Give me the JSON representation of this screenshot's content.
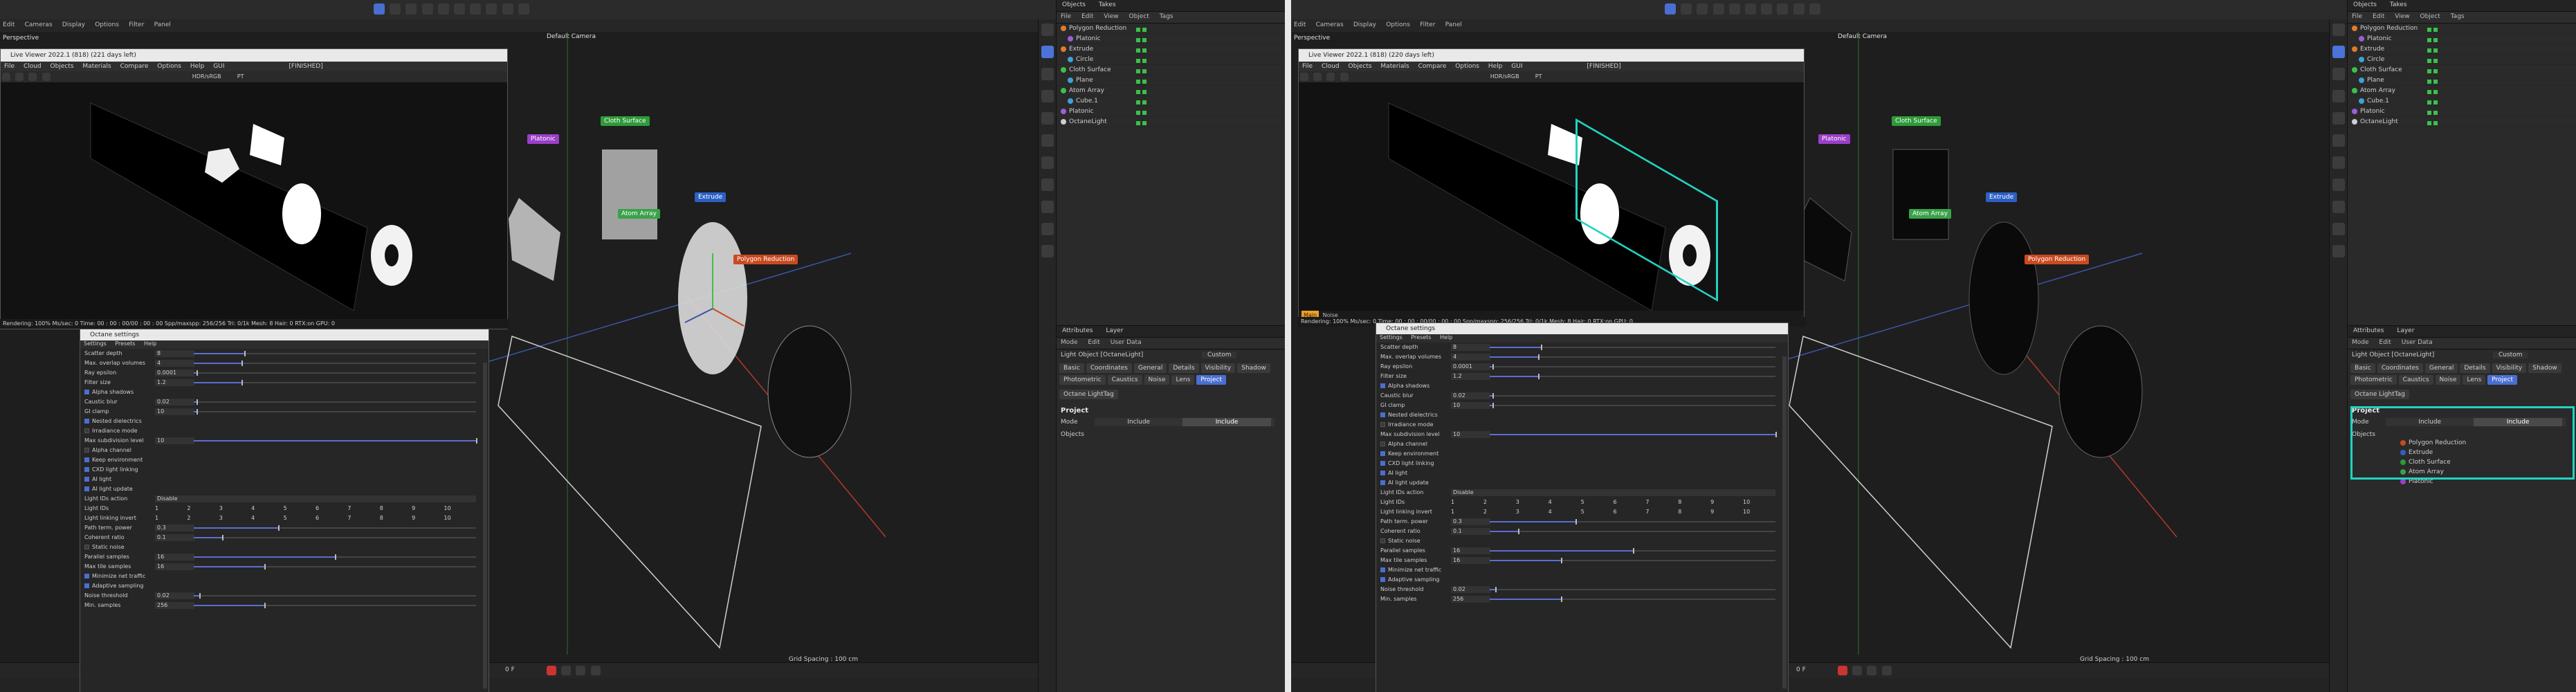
{
  "app": {
    "viewport_mode_left": "Perspective",
    "viewport_mode_right": "Perspective",
    "camera_label": "Default Camera",
    "grid_spacing": "Grid Spacing : 100 cm",
    "frame_start": "0 F",
    "main_menu": [
      "Edit",
      "Cameras",
      "Display",
      "Options",
      "Filter",
      "Panel"
    ]
  },
  "objects_panel": {
    "tabs": [
      "Objects",
      "Takes"
    ],
    "menu": [
      "File",
      "Edit",
      "View",
      "Object",
      "Tags"
    ],
    "items": [
      {
        "label": "Polygon Reduction",
        "color": "#e07b2b"
      },
      {
        "label": "Platonic",
        "color": "#9b5fd6"
      },
      {
        "label": "Extrude",
        "color": "#e07b2b"
      },
      {
        "label": "Circle",
        "color": "#3ba3d9"
      },
      {
        "label": "Cloth Surface",
        "color": "#3bc14a"
      },
      {
        "label": "Plane",
        "color": "#3ba3d9"
      },
      {
        "label": "Atom Array",
        "color": "#3bc14a"
      },
      {
        "label": "Cube.1",
        "color": "#3ba3d9"
      },
      {
        "label": "Platonic",
        "color": "#9b5fd6"
      },
      {
        "label": "OctaneLight",
        "color": "#cfcfcf"
      }
    ]
  },
  "attributes_panel": {
    "tabs": [
      "Attributes",
      "Layer"
    ],
    "menu": [
      "Mode",
      "Edit",
      "User Data"
    ],
    "object_label": "Light Object [OctaneLight]",
    "preset": "Custom",
    "section_tabs": [
      "Basic",
      "Coordinates",
      "General",
      "Details",
      "Visibility",
      "Shadow",
      "Photometric",
      "Caustics",
      "Noise",
      "Lens",
      "Project"
    ],
    "extra_tab": "Octane LightTag",
    "active_tab": "Project",
    "project_title": "Project",
    "mode_label": "Mode",
    "mode_options": [
      "Include",
      "Include"
    ],
    "objects_label": "Objects",
    "included_objects": [
      "Polygon Reduction",
      "Extrude",
      "Cloth Surface",
      "Atom Array",
      "Platonic"
    ]
  },
  "live_viewer": {
    "title": "Live Viewer 2022.1 (818) (221 days left)",
    "title_right": "Live Viewer 2022.1 (818) (220 days left)",
    "menu": [
      "File",
      "Cloud",
      "Objects",
      "Materials",
      "Compare",
      "Options",
      "Help",
      "GUI"
    ],
    "status_text": "[FINISHED]",
    "color_mode": "HDR/sRGB",
    "pt": "PT",
    "badge": "Main",
    "badge_value": "Noise",
    "status_line": "Rendering: 100%   Ms/sec: 0   Time: 00 : 00 : 00/00 : 00 : 00   Spp/maxspp: 256/256   Tri: 0/1k   Mesh: 8   Hair: 0   RTX:on   GPU: 0"
  },
  "octane_settings": {
    "title": "Octane settings",
    "menu": [
      "Settings",
      "Presets",
      "Help"
    ],
    "rows": [
      {
        "label": "Scatter depth",
        "value": "8",
        "frac": 0.18
      },
      {
        "label": "Max. overlap volumes",
        "value": "4",
        "frac": 0.17
      },
      {
        "label": "Ray epsilon",
        "value": "0.0001",
        "frac": 0.01
      },
      {
        "label": "Filter size",
        "value": "1.2",
        "frac": 0.17
      },
      {
        "label": "Alpha shadows",
        "check": true
      },
      {
        "label": "Caustic blur",
        "value": "0.02",
        "frac": 0.01
      },
      {
        "label": "GI clamp",
        "value": "10",
        "frac": 0.01
      },
      {
        "label": "Nested dielectrics",
        "check": true
      },
      {
        "label": "Irradiance mode",
        "check": false
      },
      {
        "label": "Max subdivision level",
        "value": "10",
        "frac": 1.0
      },
      {
        "label": "Alpha channel",
        "check": false
      },
      {
        "label": "Keep environment",
        "check": true
      },
      {
        "label": "CXD light linking",
        "check": true
      },
      {
        "label": "AI light",
        "check": true
      },
      {
        "label": "AI light update",
        "check": true
      },
      {
        "label": "Light IDs action",
        "dropdown": "Disable"
      },
      {
        "label": "Light IDs",
        "nums": [
          "1",
          "2",
          "3",
          "4",
          "5",
          "6",
          "7",
          "8",
          "9",
          "10"
        ]
      },
      {
        "label": "Light linking invert",
        "nums": [
          "1",
          "2",
          "3",
          "4",
          "5",
          "6",
          "7",
          "8",
          "9",
          "10"
        ]
      },
      {
        "label": "Path term. power",
        "value": "0.3",
        "frac": 0.3
      },
      {
        "label": "Coherent ratio",
        "value": "0.1",
        "frac": 0.1
      },
      {
        "label": "Static noise",
        "check": false
      },
      {
        "label": "Parallel samples",
        "value": "16",
        "frac": 0.5
      },
      {
        "label": "Max tile samples",
        "value": "16",
        "frac": 0.25
      },
      {
        "label": "Minimize net traffic",
        "check": true
      },
      {
        "label": "Adaptive sampling",
        "check": true
      },
      {
        "label": "Noise threshold",
        "value": "0.02",
        "frac": 0.02
      },
      {
        "label": "Min. samples",
        "value": "256",
        "frac": 0.25
      }
    ]
  },
  "scene_tags": [
    {
      "label": "Platonic",
      "color": "#9b3fc8"
    },
    {
      "label": "Cloth Surface",
      "color": "#2e9a3a"
    },
    {
      "label": "Atom Array",
      "color": "#3aa24a"
    },
    {
      "label": "Extrude",
      "color": "#2c60c4"
    },
    {
      "label": "Polygon Reduction",
      "color": "#c94a20"
    }
  ]
}
